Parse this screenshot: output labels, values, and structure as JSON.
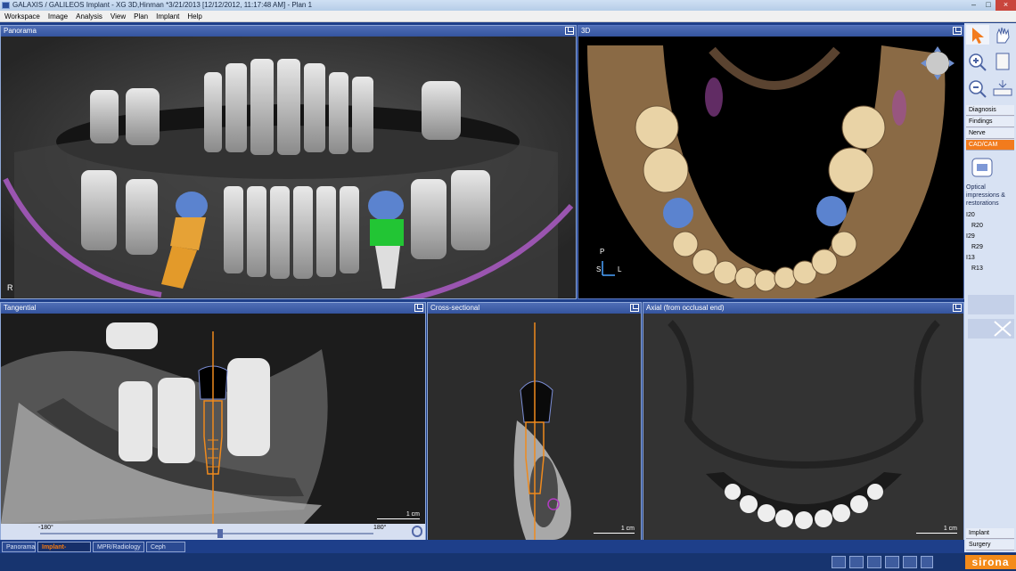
{
  "window": {
    "title": "GALAXIS / GALILEOS Implant - XG 3D,Hinman *3/21/2013 [12/12/2012, 11:17:48 AM] - Plan 1"
  },
  "menu": [
    "Workspace",
    "Image",
    "Analysis",
    "View",
    "Plan",
    "Implant",
    "Help"
  ],
  "panels": {
    "panorama": {
      "title": "Panorama",
      "side_marker": "R"
    },
    "view3d": {
      "title": "3D",
      "orient_p": "P",
      "orient_l": "L",
      "orient_s": "S"
    },
    "tangential": {
      "title": "Tangential",
      "scale": "1 cm",
      "slider_min": "-180°",
      "slider_max": "180°"
    },
    "cross": {
      "title": "Cross-sectional",
      "scale": "1 cm"
    },
    "axial": {
      "title": "Axial (from occlusal end)",
      "scale": "1 cm"
    }
  },
  "sidebar": {
    "menu": [
      "Diagnosis",
      "Findings",
      "Nerve",
      "CAD/CAM"
    ],
    "active": "CAD/CAM",
    "optical_label": "Optical impressions & restorations",
    "implants": [
      {
        "id": "I20",
        "restoration": "R20"
      },
      {
        "id": "I29",
        "restoration": "R29"
      },
      {
        "id": "I13",
        "restoration": "R13"
      }
    ],
    "bottom": [
      "Implant",
      "Surgery"
    ]
  },
  "tabs": [
    "Panorama",
    "Implant-Aligned",
    "MPR/Radiology",
    "Ceph lateral"
  ],
  "active_tab": "Implant-Aligned",
  "brand": "sirona",
  "colors": {
    "accent": "#f27b1d",
    "frame": "#1e3f8a",
    "implant_orange": "#e29a2b",
    "implant_green": "#1fb82d",
    "crown_blue": "#4f78c8",
    "nerve": "#a05ab0"
  }
}
